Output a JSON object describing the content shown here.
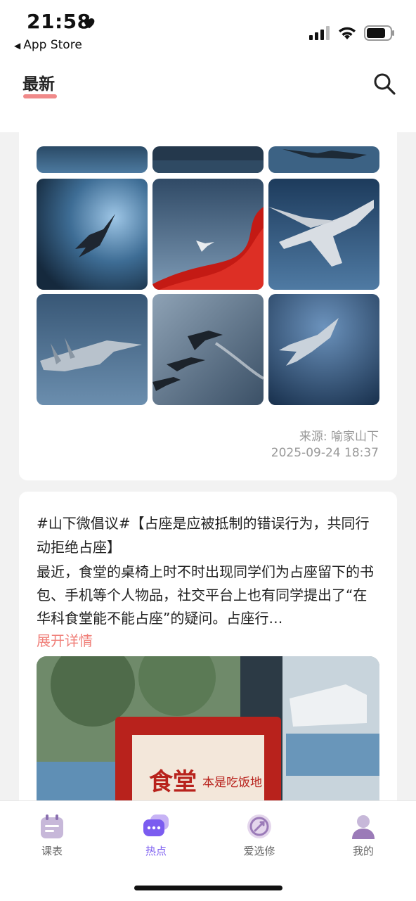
{
  "status_bar": {
    "time": "21:58",
    "back_label": "App Store",
    "icons": [
      "heart-icon",
      "signal-icon",
      "wifi-icon",
      "battery-icon"
    ]
  },
  "header": {
    "tab_label": "最新",
    "accent_color": "#f08a8a",
    "search_icon": "search-icon"
  },
  "feed": {
    "card1": {
      "source": "来源: 喻家山下",
      "datetime": "2025-09-24 18:37"
    },
    "card2": {
      "title": "#山下微倡议#【占座是应被抵制的错误行为，共同行动拒绝占座】",
      "body": "最近，食堂的桌椅上时不时出现同学们为占座留下的书包、手机等个人物品，社交平台上也有同学提出了“在华科食堂能不能占座”的疑问。占座行…",
      "expand_label": "展开详情",
      "photo_sign_text": "食堂",
      "photo_sign_subtext": "本是吃饭地"
    }
  },
  "bottom_nav": {
    "items": [
      {
        "label": "课表",
        "icon": "calendar-icon"
      },
      {
        "label": "热点",
        "icon": "chat-bubbles-icon"
      },
      {
        "label": "爱选修",
        "icon": "course-select-icon"
      },
      {
        "label": "我的",
        "icon": "user-icon"
      }
    ],
    "active_color": "#7b5cf0"
  }
}
